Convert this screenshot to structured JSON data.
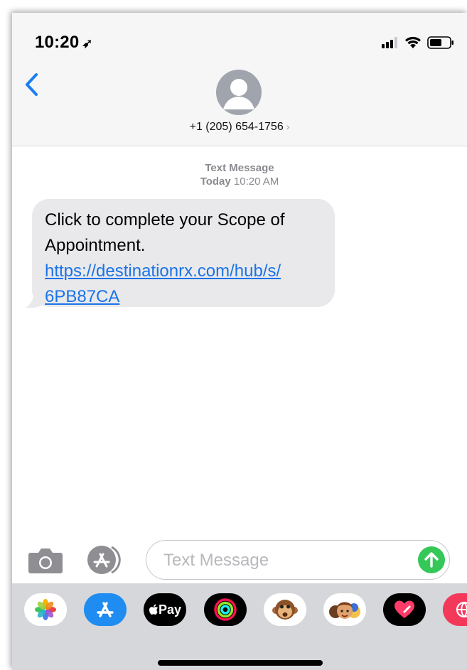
{
  "status_bar": {
    "time": "10:20",
    "location_icon": "location-arrow-icon",
    "icons": [
      "cellular-signal-icon",
      "wifi-icon",
      "battery-icon"
    ]
  },
  "header": {
    "back_icon": "back-chevron-icon",
    "avatar_icon": "person-avatar-icon",
    "contact": "+1 (205) 654-1756",
    "contact_chevron": "›"
  },
  "conversation": {
    "service": "Text Message",
    "day": "Today",
    "time": "10:20 AM",
    "message": {
      "line1": "Click to complete your Scope of",
      "line2": "Appointment.",
      "link_line1": "https://destinationrx.com/hub/s/",
      "link_line2": "6PB87CA"
    }
  },
  "composer": {
    "placeholder": "Text Message",
    "camera_icon": "camera-icon",
    "apps_icon": "app-store-icon",
    "send_icon": "send-arrow-icon"
  },
  "app_drawer": {
    "items": [
      {
        "name": "photos-app-icon"
      },
      {
        "name": "app-store-app-icon"
      },
      {
        "name": "apple-pay-app-icon",
        "label": "Pay"
      },
      {
        "name": "activity-app-icon"
      },
      {
        "name": "animoji-monkey-icon"
      },
      {
        "name": "memoji-icon"
      },
      {
        "name": "digital-touch-icon"
      },
      {
        "name": "web-search-app-icon"
      }
    ]
  },
  "colors": {
    "accent_blue": "#1a7ef2",
    "send_green": "#36c759",
    "bubble_gray": "#e9e9eb",
    "drawer_gray": "#d6d7db"
  }
}
